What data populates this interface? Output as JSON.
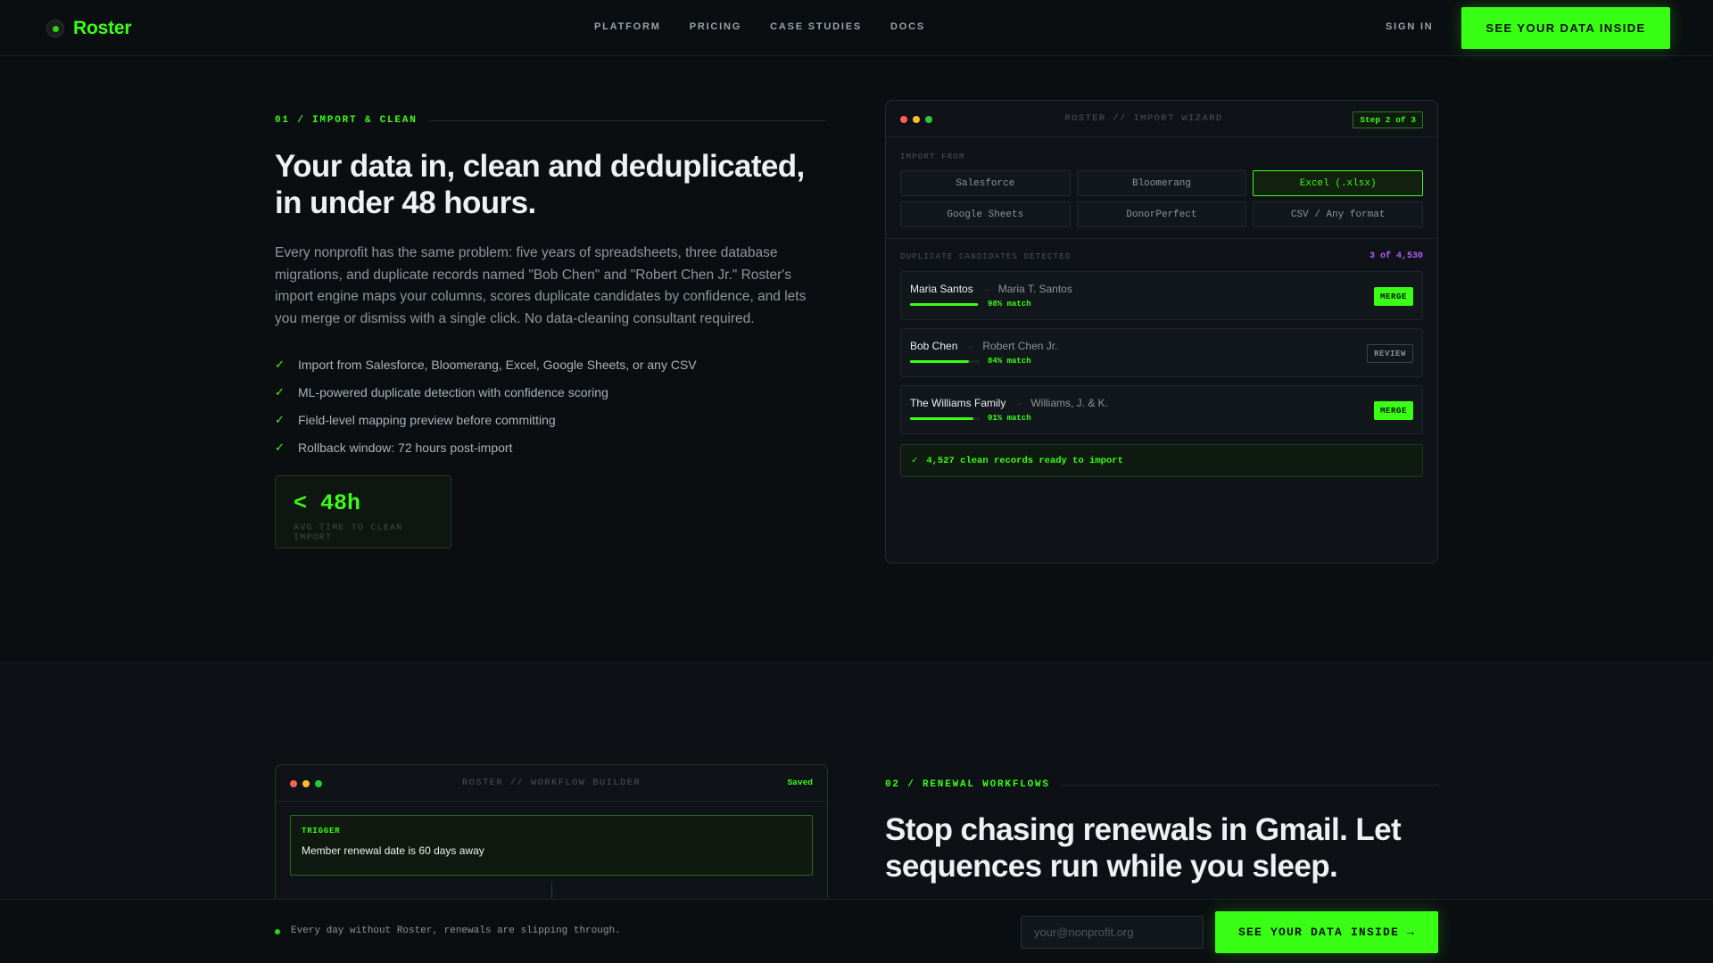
{
  "nav": {
    "logo_text": "Roster",
    "links": [
      "PLATFORM",
      "PRICING",
      "CASE STUDIES",
      "DOCS"
    ],
    "signin": "SIGN IN",
    "cta": "SEE YOUR DATA INSIDE"
  },
  "section1": {
    "label": "01 / IMPORT & CLEAN",
    "title": "Your data in, clean and deduplicated, in under 48 hours.",
    "body": "Every nonprofit has the same problem: five years of spreadsheets, three database migrations, and duplicate records named \"Bob Chen\" and \"Robert Chen Jr.\" Roster's import engine maps your columns, scores duplicate candidates by confidence, and lets you merge or dismiss with a single click. No data-cleaning consultant required.",
    "checklist": [
      "Import from Salesforce, Bloomerang, Excel, Google Sheets, or any CSV",
      "ML-powered duplicate detection with confidence scoring",
      "Field-level mapping preview before committing",
      "Rollback window: 72 hours post-import"
    ],
    "stat": {
      "value": "< 48h",
      "label": "AVG TIME TO CLEAN IMPORT"
    }
  },
  "wizard": {
    "title": "ROSTER // IMPORT WIZARD",
    "step": "Step 2 of 3",
    "import_from_label": "IMPORT FROM",
    "sources": [
      {
        "label": "Salesforce",
        "active": false
      },
      {
        "label": "Bloomerang",
        "active": false
      },
      {
        "label": "Excel (.xlsx)",
        "active": true
      },
      {
        "label": "Google Sheets",
        "active": false
      },
      {
        "label": "DonorPerfect",
        "active": false
      },
      {
        "label": "CSV / Any format",
        "active": false
      }
    ],
    "dup_label": "DUPLICATE CANDIDATES DETECTED",
    "dup_count": "3 of 4,530",
    "duplicates": [
      {
        "a": "Maria Santos",
        "b": "Maria T. Santos",
        "match": "98% match",
        "pct": 98,
        "action": "MERGE",
        "type": "merge"
      },
      {
        "a": "Bob Chen",
        "b": "Robert Chen Jr.",
        "match": "84% match",
        "pct": 84,
        "action": "REVIEW",
        "type": "review"
      },
      {
        "a": "The Williams Family",
        "b": "Williams, J. & K.",
        "match": "91% match",
        "pct": 91,
        "action": "MERGE",
        "type": "merge"
      }
    ],
    "clean_text": "4,527 clean records ready to import"
  },
  "workflow": {
    "title": "ROSTER // WORKFLOW BUILDER",
    "saved": "Saved",
    "trigger_label": "TRIGGER",
    "trigger_text": "Member renewal date is 60 days away"
  },
  "section2": {
    "label": "02 / RENEWAL WORKFLOWS",
    "title": "Stop chasing renewals in Gmail. Let sequences run while you sleep."
  },
  "sticky": {
    "text": "Every day without Roster, renewals are slipping through.",
    "email_placeholder": "your@nonprofit.org",
    "cta": "SEE YOUR DATA INSIDE →"
  },
  "colors": {
    "accent": "#39ff14",
    "background": "#0b0e11",
    "count": "#b45cff"
  }
}
